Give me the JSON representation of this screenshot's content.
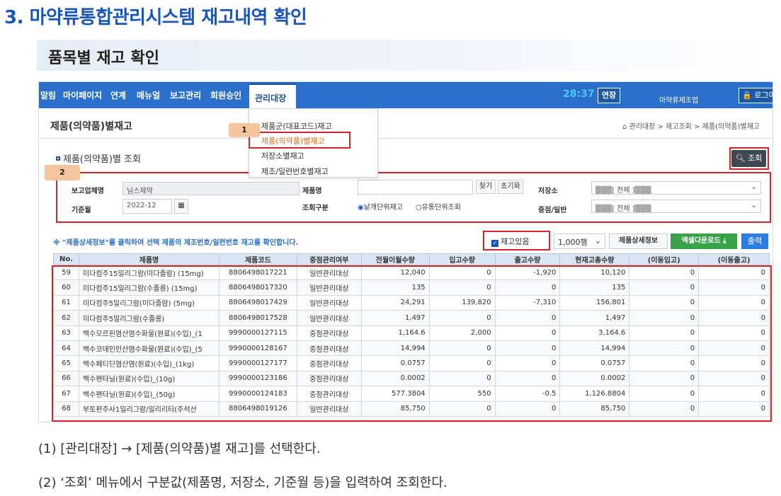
{
  "doc": {
    "title": "3. 마약류통합관리시스템 재고내역 확인",
    "subtitle": "품목별 재고 확인",
    "captions": [
      "(1) [관리대장] → [제품(의약품)별 재고]를 선택한다.",
      "(2) ‘조회’ 메뉴에서 구분값(제품명, 저장소, 기준월 등)을 입력하여 조회한다."
    ]
  },
  "nav": {
    "items": [
      "알림",
      "마이페이지",
      "연계",
      "매뉴얼",
      "보고관리",
      "회원승인"
    ],
    "active": "관리대장",
    "timer": "28:37",
    "extend": "연장",
    "company": "마약류제조업",
    "logout": "로그아웃"
  },
  "page": {
    "title": "제품(의약품)별재고",
    "breadcrumb": "관리대장 > 재고조회 > 제품(의약품)별재고",
    "section": "제품(의약품)별 조회",
    "search_btn": "조회"
  },
  "dropdown": {
    "items": [
      "제품군(대표코드)재고",
      "제품(의약품)별재고",
      "저장소별재고",
      "제조/일련번호별재고"
    ]
  },
  "badges": [
    "1",
    "2"
  ],
  "form": {
    "company_label": "보고업체명",
    "company_value": "님스제약",
    "base_month_label": "기준월",
    "base_month_value": "2022-12",
    "product_label": "제품명",
    "product_value": "",
    "find_btn": "찾기",
    "reset_btn": "초기화",
    "query_type_label": "조회구분",
    "radio_unit": "낱개단위재고",
    "radio_distribution": "유통단위조회",
    "storage_label": "저장소",
    "storage_value": "▒▒▒[ 전체 ]▒▒▒",
    "weight_label": "중점/일반",
    "weight_value": "▒▒▒[ 전체 ]▒▒▒"
  },
  "toolbar": {
    "notice": "※ \"제품상세정보\"를 클릭하여 선택 제품의 제조번호/일련번호 재고를 확인합니다.",
    "has_stock": "재고있음",
    "rows": "1,000행",
    "detail_btn": "제품상세정보",
    "excel_btn": "엑셀다운로드",
    "print_btn": "출력"
  },
  "table": {
    "headers": [
      "No.",
      "제품명",
      "제품코드",
      "중점관리여부",
      "전월이월수량",
      "입고수량",
      "출고수량",
      "현재고총수량",
      "(이동입고)",
      "(이동출고)"
    ],
    "rows": [
      [
        "59",
        "미다컴주15밀리그람(미다졸람) (15mg)",
        "8806498017221",
        "일반관리대상",
        "12,040",
        "0",
        "-1,920",
        "10,120",
        "0",
        "0"
      ],
      [
        "60",
        "미다컴주15밀리그람(수졸롱) (15mg)",
        "8806498017320",
        "일반관리대상",
        "135",
        "0",
        "0",
        "135",
        "0",
        "0"
      ],
      [
        "61",
        "미다컴주5밀리그람(미다졸람) (5mg)",
        "8806498017429",
        "일반관리대상",
        "24,291",
        "139,820",
        "-7,310",
        "156,801",
        "0",
        "0"
      ],
      [
        "62",
        "미다컴주5밀리그람(수졸롱)",
        "8806498017528",
        "일반관리대상",
        "1,497",
        "0",
        "0",
        "1,497",
        "0",
        "0"
      ],
      [
        "63",
        "백수모르핀염산염수화물(원료)(수입)_(1",
        "9990000127115",
        "중점관리대상",
        "1,164.6",
        "2,000",
        "0",
        "3,164.6",
        "0",
        "0"
      ],
      [
        "64",
        "백수코데인인산염수화물(원료)(수입)_(5",
        "9990000128167",
        "중점관리대상",
        "14,994",
        "0",
        "0",
        "14,994",
        "0",
        "0"
      ],
      [
        "65",
        "백수페티딘염산염(원료)(수입)_(1kg)",
        "9990000127177",
        "중점관리대상",
        "0.0757",
        "0",
        "0",
        "0.0757",
        "0",
        "0"
      ],
      [
        "66",
        "백수펜타닐(원료)(수입)_(10g)",
        "9990000123186",
        "중점관리대상",
        "0.0002",
        "0",
        "0",
        "0.0002",
        "0",
        "0"
      ],
      [
        "67",
        "백수펜타닐(원료)(수입)_(50g)",
        "9990000124183",
        "중점관리대상",
        "577.3804",
        "550",
        "-0.5",
        "1,126.8804",
        "0",
        "0"
      ],
      [
        "68",
        "부토판주사1밀리그람/밀리리터(주석산",
        "8806498019126",
        "일반관리대상",
        "85,750",
        "0",
        "0",
        "85,750",
        "0",
        "0"
      ]
    ]
  }
}
